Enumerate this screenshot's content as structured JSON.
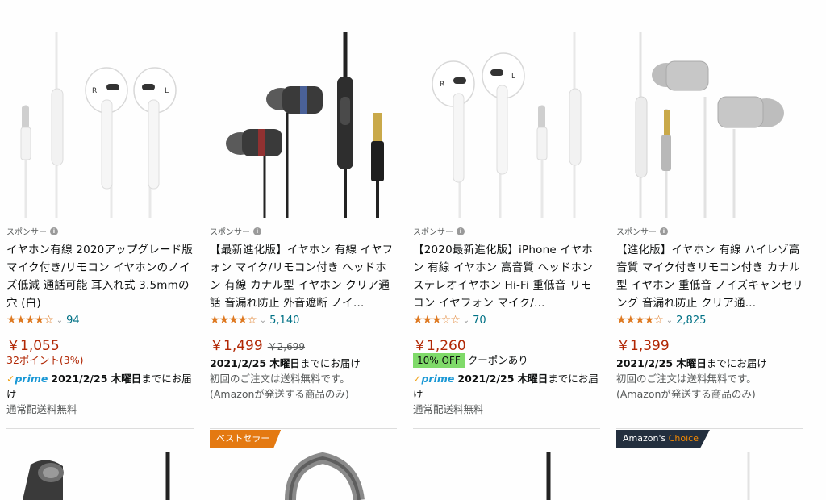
{
  "products": [
    {
      "sponsored_label": "スポンサー",
      "title": "イヤホン有線 2020アップグレード版 マイク付き/リモコン イヤホンのノイズ低減 通話可能 耳入れ式 3.5mmの穴 (白)",
      "stars": "★★★★☆",
      "rating_count": "94",
      "price": "￥1,055",
      "points": "32ポイント(3%)",
      "prime_label": "prime",
      "delivery_date": "2021/2/25 木曜日",
      "delivery_suffix": "までにお届け",
      "shipping": "通常配送料無料"
    },
    {
      "sponsored_label": "スポンサー",
      "title": "【最新進化版】イヤホン 有線 イヤフォン マイク/リモコン付き ヘッドホン 有線 カナル型 イヤホン クリア通話 音漏れ防止 外音遮断 ノイ…",
      "stars": "★★★★☆",
      "rating_count": "5,140",
      "price": "￥1,499",
      "list_price": "￥2,699",
      "delivery_date": "2021/2/25 木曜日",
      "delivery_suffix": "までにお届け",
      "first_order": "初回のご注文は送料無料です。",
      "amazon_ship": "(Amazonが発送する商品のみ)",
      "badge": "ベストセラー"
    },
    {
      "sponsored_label": "スポンサー",
      "title": "【2020最新進化版】iPhone イヤホン 有線 イヤホン 高音質 ヘッドホン ステレオイヤホン Hi-Fi 重低音 リモコン イヤフォン マイク/…",
      "stars": "★★★☆☆",
      "rating_count": "70",
      "price": "￥1,260",
      "coupon_badge": "10% OFF",
      "coupon_text": "クーポンあり",
      "prime_label": "prime",
      "delivery_date": "2021/2/25 木曜日",
      "delivery_suffix": "までにお届け",
      "shipping": "通常配送料無料"
    },
    {
      "sponsored_label": "スポンサー",
      "title": "【進化版】イヤホン 有線 ハイレゾ高音質 マイク付きリモコン付き カナル型 イヤホン 重低音 ノイズキャンセリング 音漏れ防止 クリア通…",
      "stars": "★★★★☆",
      "rating_count": "2,825",
      "price": "￥1,399",
      "delivery_date": "2021/2/25 木曜日",
      "delivery_suffix": "までにお届け",
      "first_order": "初回のご注文は送料無料です。",
      "amazon_ship": "(Amazonが発送する商品のみ)",
      "badge_prefix": "Amazon's",
      "badge_accent": "Choice"
    }
  ],
  "colors": {
    "price": "#b12704",
    "rating_link": "#007185",
    "star": "#de7921",
    "prime": "#1a98d5",
    "coupon": "#7fda69",
    "best_seller": "#e47911",
    "choice": "#232f3e"
  }
}
